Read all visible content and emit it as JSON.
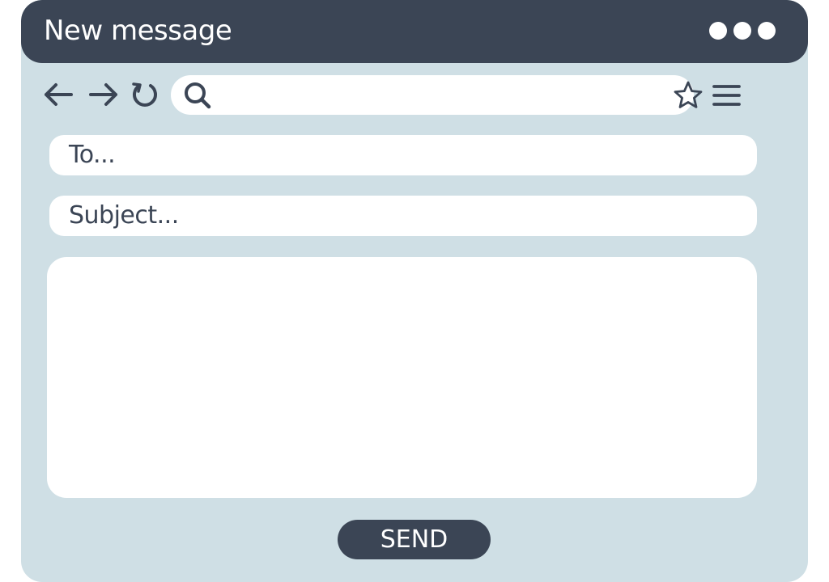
{
  "window": {
    "title": "New message",
    "colors": {
      "titlebar": "#3b4555",
      "background": "#cfdfe5",
      "field": "#ffffff",
      "button": "#3b4555"
    }
  },
  "toolbar": {
    "icons": [
      "back-arrow-icon",
      "forward-arrow-icon",
      "refresh-icon",
      "search-icon",
      "star-icon",
      "menu-icon"
    ],
    "search_value": ""
  },
  "compose": {
    "to_placeholder": "To...",
    "subject_placeholder": "Subject...",
    "body_value": ""
  },
  "actions": {
    "send_label": "SEND"
  },
  "window_controls": {
    "icon": "more-dots-icon"
  }
}
